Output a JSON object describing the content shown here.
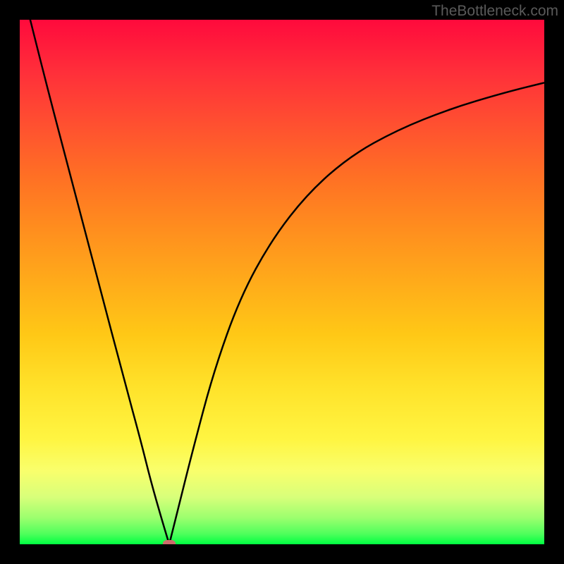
{
  "watermark": "TheBottleneck.com",
  "colors": {
    "frame": "#000000",
    "curve": "#000000",
    "marker": "#cc6b6b"
  },
  "chart_data": {
    "type": "line",
    "title": "",
    "xlabel": "",
    "ylabel": "",
    "xlim": [
      0,
      100
    ],
    "ylim": [
      0,
      100
    ],
    "grid": false,
    "legend": false,
    "series": [
      {
        "name": "left-branch",
        "x": [
          0,
          5,
          10,
          15,
          20,
          23,
          25,
          27,
          28.5
        ],
        "y": [
          108,
          88,
          69,
          50,
          31,
          20,
          12,
          5,
          0
        ]
      },
      {
        "name": "right-branch",
        "x": [
          28.5,
          30,
          33,
          37,
          42,
          48,
          55,
          63,
          72,
          82,
          92,
          100
        ],
        "y": [
          0,
          6,
          18,
          33,
          47,
          58,
          67,
          74,
          79,
          83,
          86,
          88
        ]
      }
    ],
    "markers": [
      {
        "name": "minimum",
        "x": 28.5,
        "y": 0
      }
    ],
    "gradient_stops": [
      {
        "pct": 0,
        "color": "#ff0a3c"
      },
      {
        "pct": 50,
        "color": "#ffab1a"
      },
      {
        "pct": 80,
        "color": "#fff542"
      },
      {
        "pct": 100,
        "color": "#00ff41"
      }
    ]
  }
}
